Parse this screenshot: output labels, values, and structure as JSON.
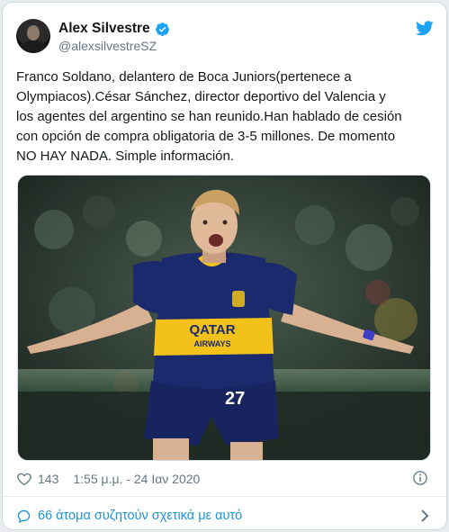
{
  "author": {
    "name": "Alex Silvestre",
    "handle": "@alexsilvestreSZ",
    "avatar_icon": "profile-avatar",
    "verified_icon": "verified-badge-icon",
    "brand_icon": "twitter-bird-icon"
  },
  "tweet": {
    "text": "Franco Soldano, delantero de Boca Juniors(pertenece a\nOlympiacos).César Sánchez, director deportivo del Valencia y\nlos agentes del argentino se han reunido.Han hablado de cesión\ncon opción de compra obligatoria de 3-5 millones. De momento\nNO HAY NADA. Simple información.",
    "image": {
      "jersey_sponsor_line1": "QATAR",
      "jersey_sponsor_line2": "AIRWAYS",
      "jersey_number": "27"
    }
  },
  "footer": {
    "likes": "143",
    "timestamp": "1:55 μ.μ. - 24 Ιαν 2020",
    "discussion": "66 άτομα συζητούν σχετικά με αυτό"
  },
  "colors": {
    "accent": "#1da1f2",
    "link": "#1b95e0",
    "muted": "#657786",
    "boca_blue": "#1a2a6c",
    "boca_gold": "#f2c21b"
  }
}
